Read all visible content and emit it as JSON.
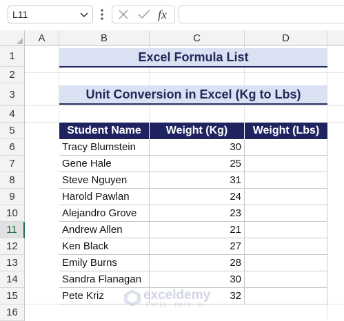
{
  "formula_bar": {
    "name_box": "L11",
    "fx_label": "fx",
    "formula": ""
  },
  "columns": [
    "A",
    "B",
    "C",
    "D"
  ],
  "rows": [
    "1",
    "2",
    "3",
    "4",
    "5",
    "6",
    "7",
    "8",
    "9",
    "10",
    "11",
    "12",
    "13",
    "14",
    "15",
    "16"
  ],
  "selected_row": "11",
  "sheet": {
    "title": "Excel Formula List",
    "subtitle": "Unit Conversion in Excel (Kg to Lbs)",
    "headers": [
      "Student Name",
      "Weight (Kg)",
      "Weight (Lbs)"
    ],
    "records": [
      {
        "name": "Tracy Blumstein",
        "kg": "30",
        "lbs": ""
      },
      {
        "name": "Gene Hale",
        "kg": "25",
        "lbs": ""
      },
      {
        "name": "Steve Nguyen",
        "kg": "31",
        "lbs": ""
      },
      {
        "name": "Harold Pawlan",
        "kg": "24",
        "lbs": ""
      },
      {
        "name": "Alejandro Grove",
        "kg": "23",
        "lbs": ""
      },
      {
        "name": "Andrew Allen",
        "kg": "21",
        "lbs": ""
      },
      {
        "name": "Ken Black",
        "kg": "27",
        "lbs": ""
      },
      {
        "name": "Emily Burns",
        "kg": "28",
        "lbs": ""
      },
      {
        "name": "Sandra Flanagan",
        "kg": "30",
        "lbs": ""
      },
      {
        "name": "Pete Kriz",
        "kg": "32",
        "lbs": ""
      }
    ]
  },
  "watermark": {
    "name": "exceldemy",
    "tagline": "EXCEL · DATA · BI"
  },
  "colors": {
    "header_fill": "#1f2461",
    "banner_fill": "#d9e1f2",
    "banner_text": "#22285a",
    "selection_accent": "#1e7145"
  },
  "icons": [
    "chevron-down-icon",
    "more-options-icon",
    "cancel-icon",
    "enter-icon",
    "insert-function-icon"
  ]
}
